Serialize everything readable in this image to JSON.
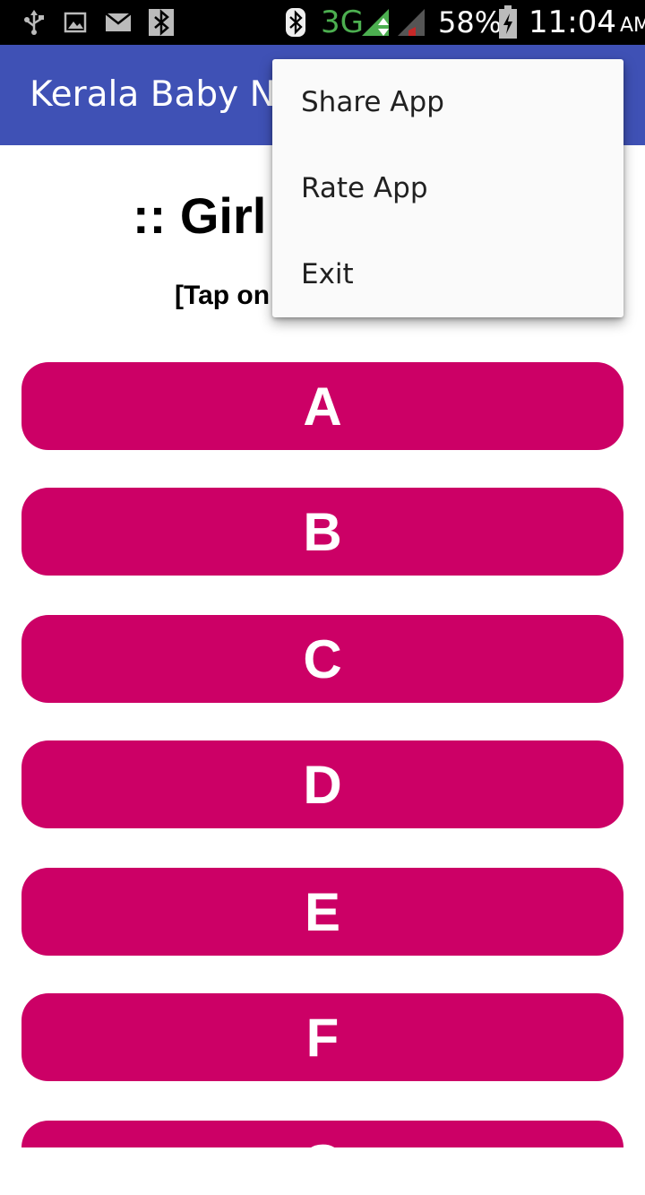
{
  "status_bar": {
    "network": "3G",
    "battery": "58%",
    "time": "11:04",
    "ampm": "AM",
    "icons": [
      "usb-icon",
      "image-icon",
      "mail-icon",
      "bluetooth-notification-icon",
      "bluetooth-icon",
      "signal-icon",
      "signal-weak-icon",
      "battery-icon"
    ]
  },
  "app_bar": {
    "title": "Kerala Baby Na"
  },
  "main": {
    "heading": ":: Girl",
    "subheading": "[Tap on",
    "letters": [
      "A",
      "B",
      "C",
      "D",
      "E",
      "F",
      "G"
    ]
  },
  "overflow_menu": {
    "items": [
      {
        "label": "Share App"
      },
      {
        "label": "Rate App"
      },
      {
        "label": "Exit"
      }
    ]
  },
  "colors": {
    "status_bar": "#000000",
    "app_bar": "#3f51b5",
    "letter_button": "#cc0066",
    "menu_background": "#fafafa",
    "network_green": "#4caf50"
  }
}
